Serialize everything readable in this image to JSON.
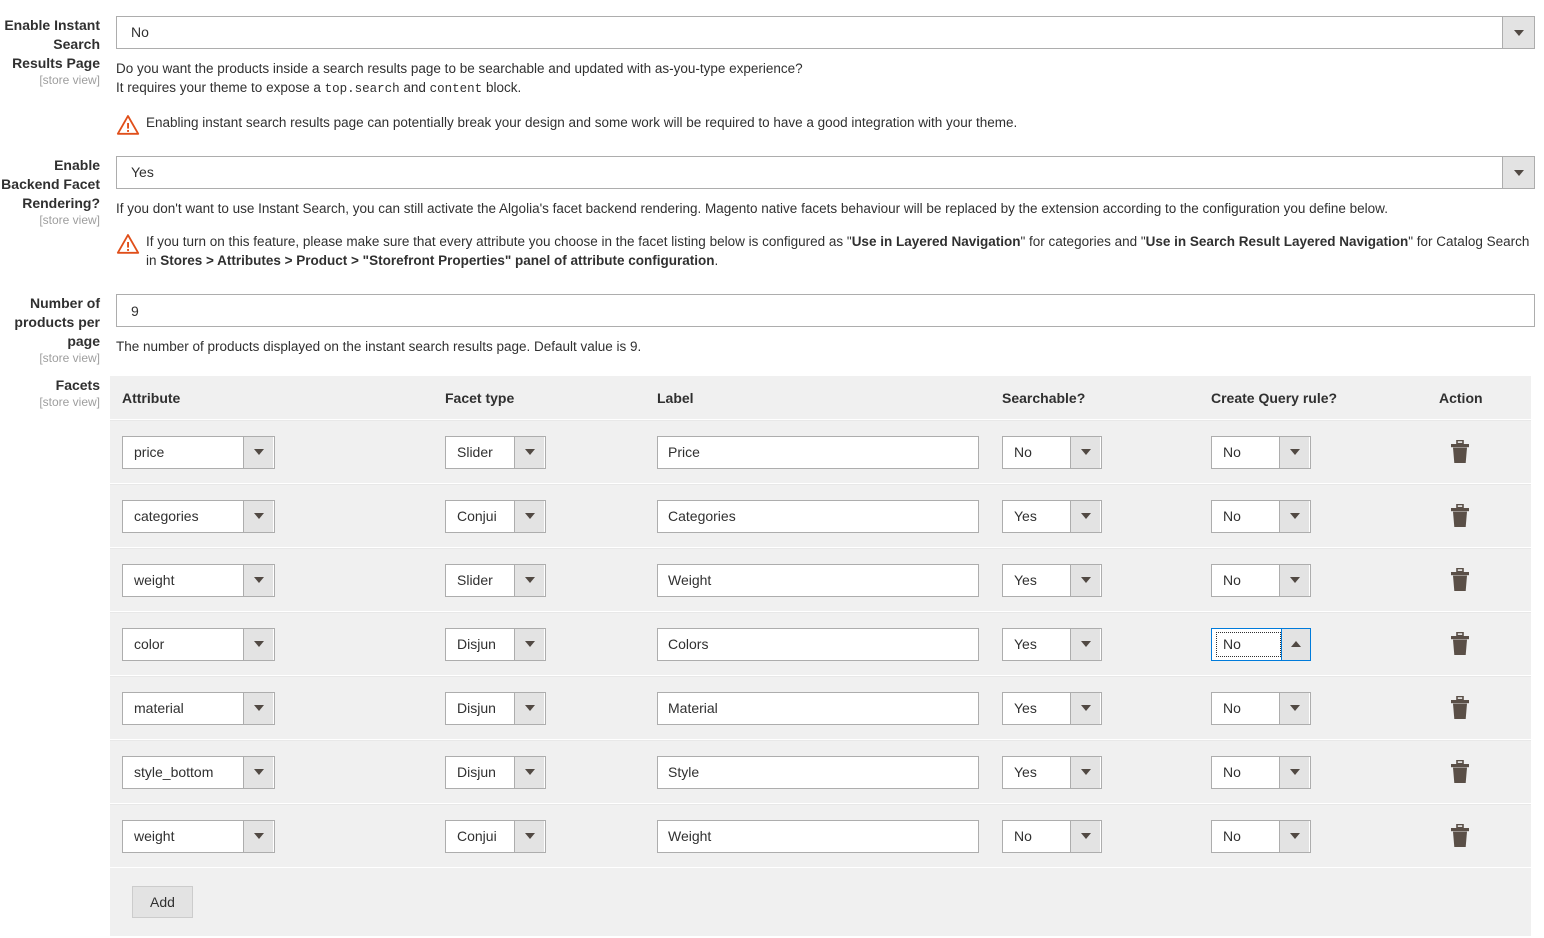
{
  "colors": {
    "warning": "#e04f1a",
    "focus_border": "#007bdb",
    "table_bg": "#f0f0f0",
    "border": "#adadad",
    "text": "#303030",
    "scope_text": "#9e9e9e"
  },
  "fields": {
    "instant_search": {
      "label": "Enable Instant Search Results Page",
      "scope": "[store view]",
      "value": "No",
      "note_line1_a": "Do you want the products inside a search results page to be searchable and updated with as-you-type experience?",
      "note_line2_a": "It requires your theme to expose a ",
      "note_code1": "top.search",
      "note_line2_b": " and ",
      "note_code2": "content",
      "note_line2_c": " block.",
      "warning": "Enabling instant search results page can potentially break your design and some work will be required to have a good integration with your theme."
    },
    "backend_facet": {
      "label": "Enable Backend Facet Rendering?",
      "scope": "[store view]",
      "value": "Yes",
      "note": "If you don't want to use Instant Search, you can still activate the Algolia's facet backend rendering. Magento native facets behaviour will be replaced by the extension according to the configuration you define below.",
      "warning_a": "If you turn on this feature, please make sure that every attribute you choose in the facet listing below is configured as \"",
      "warning_b1": "Use in Layered Navigation",
      "warning_c": "\" for categories and \"",
      "warning_b2": "Use in Search Result Layered Navigation",
      "warning_d": "\" for Catalog Search in ",
      "warning_b3": "Stores > Attributes > Product > \"Storefront Properties\" panel of attribute configuration",
      "warning_e": "."
    },
    "products_per_page": {
      "label": "Number of products per page",
      "scope": "[store view]",
      "value": "9",
      "note": "The number of products displayed on the instant search results page. Default value is 9."
    },
    "facets": {
      "label": "Facets",
      "scope": "[store view]"
    }
  },
  "facets_table": {
    "columns": {
      "attribute": "Attribute",
      "facet_type": "Facet type",
      "label": "Label",
      "searchable": "Searchable?",
      "query_rule": "Create Query rule?",
      "action": "Action"
    },
    "add_button": "Add",
    "delete_icon": "trash-icon",
    "rows": [
      {
        "attribute": "price",
        "facet_type": "Slider",
        "label": "Price",
        "searchable": "No",
        "query_rule": "No",
        "query_rule_focused": false
      },
      {
        "attribute": "categories",
        "facet_type": "Conjui",
        "label": "Categories",
        "searchable": "Yes",
        "query_rule": "No",
        "query_rule_focused": false
      },
      {
        "attribute": "weight",
        "facet_type": "Slider",
        "label": "Weight",
        "searchable": "Yes",
        "query_rule": "No",
        "query_rule_focused": false
      },
      {
        "attribute": "color",
        "facet_type": "Disjun",
        "label": "Colors",
        "searchable": "Yes",
        "query_rule": "No",
        "query_rule_focused": true
      },
      {
        "attribute": "material",
        "facet_type": "Disjun",
        "label": "Material",
        "searchable": "Yes",
        "query_rule": "No",
        "query_rule_focused": false
      },
      {
        "attribute": "style_bottom",
        "facet_type": "Disjun",
        "label": "Style",
        "searchable": "Yes",
        "query_rule": "No",
        "query_rule_focused": false
      },
      {
        "attribute": "weight",
        "facet_type": "Conjui",
        "label": "Weight",
        "searchable": "No",
        "query_rule": "No",
        "query_rule_focused": false
      }
    ]
  }
}
